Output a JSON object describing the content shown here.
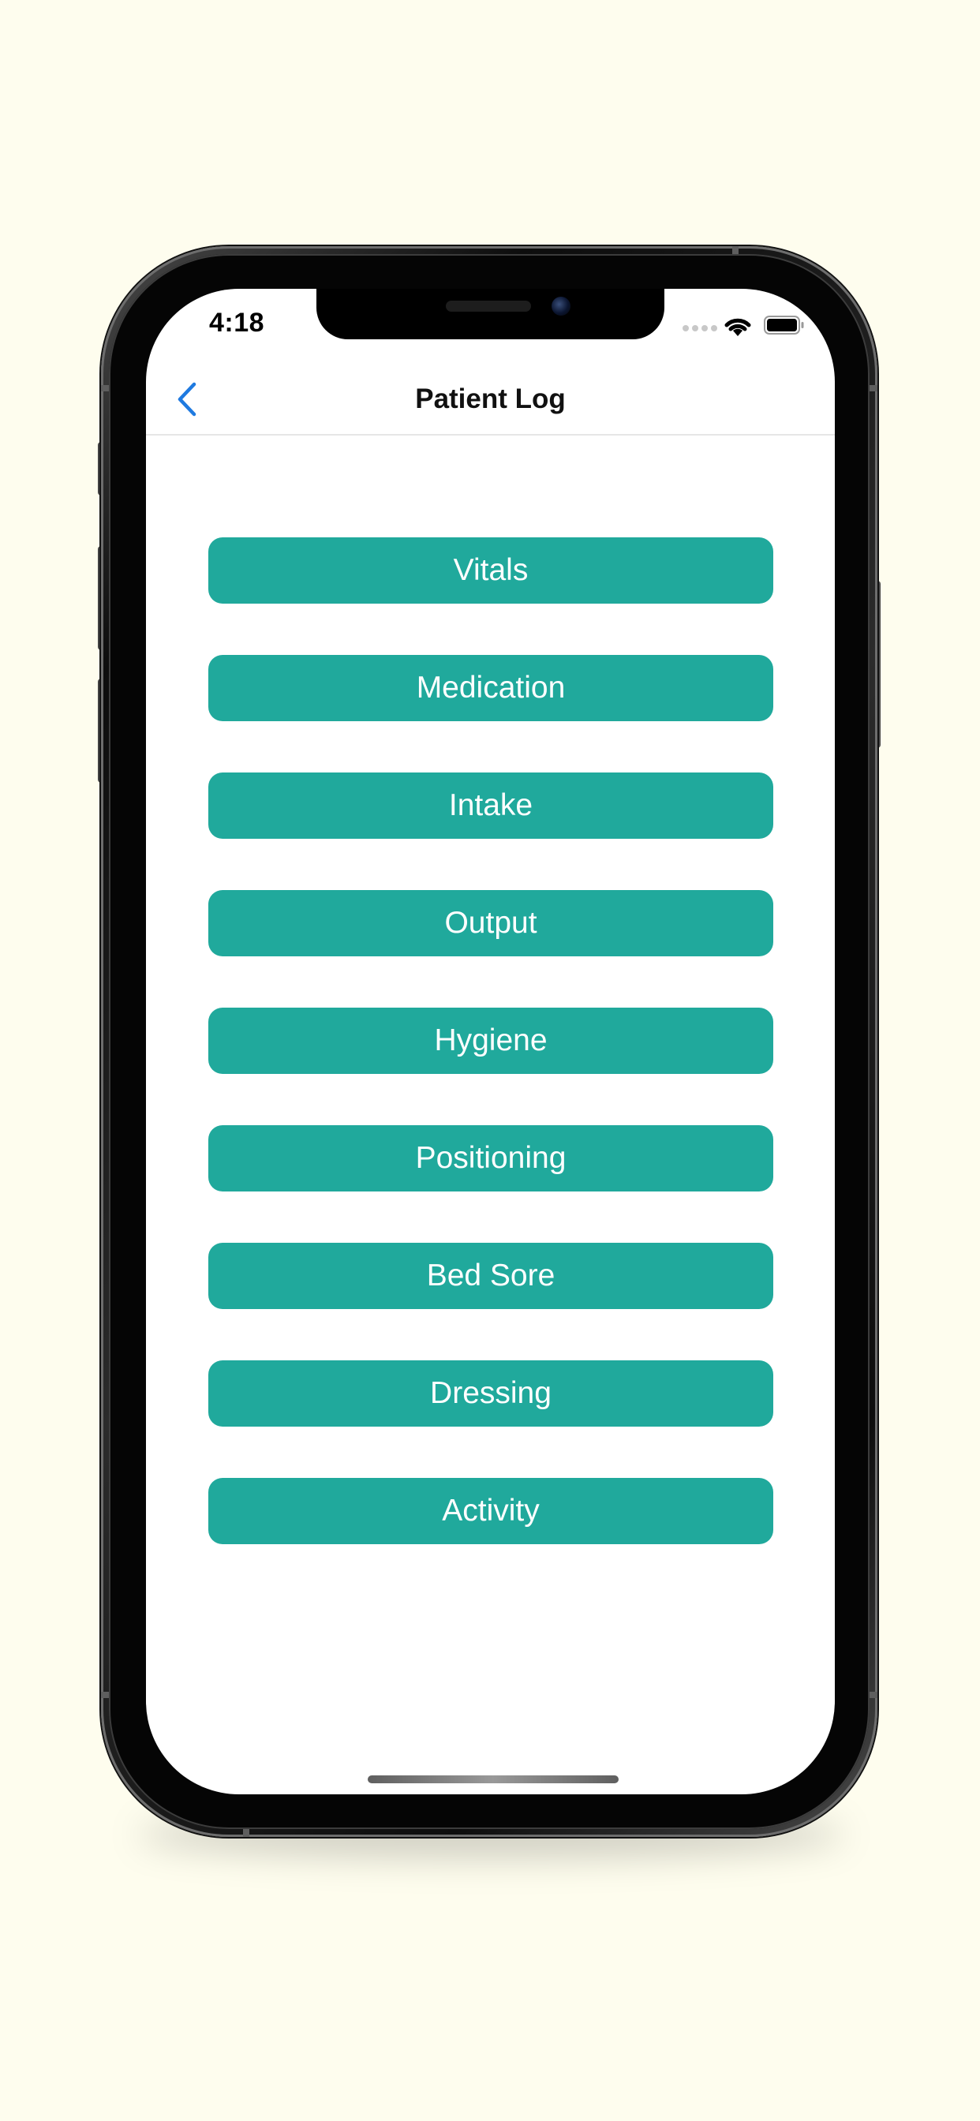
{
  "status_bar": {
    "time": "4:18",
    "wifi_icon": "wifi-icon",
    "battery_icon": "battery-icon"
  },
  "nav": {
    "back_icon": "chevron-left-icon",
    "title": "Patient Log"
  },
  "colors": {
    "background": "#fefdee",
    "accent": "#1f7ae0",
    "button": "#20a99c",
    "button_text": "#ffffff"
  },
  "buttons": [
    {
      "label": "Vitals"
    },
    {
      "label": "Medication"
    },
    {
      "label": "Intake"
    },
    {
      "label": "Output"
    },
    {
      "label": "Hygiene"
    },
    {
      "label": "Positioning"
    },
    {
      "label": "Bed Sore"
    },
    {
      "label": "Dressing"
    },
    {
      "label": "Activity"
    }
  ]
}
